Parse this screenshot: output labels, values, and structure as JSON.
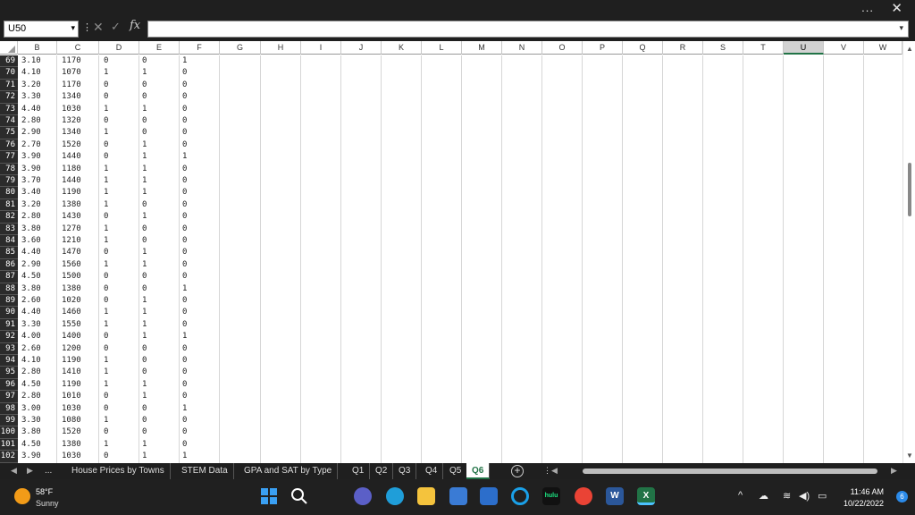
{
  "window": {
    "more_label": "...",
    "close_label": "✕"
  },
  "formula_bar": {
    "name_box": "U50",
    "formula": "",
    "fx_label": "fx"
  },
  "columns": [
    "B",
    "C",
    "D",
    "E",
    "F",
    "G",
    "H",
    "I",
    "J",
    "K",
    "L",
    "M",
    "N",
    "O",
    "P",
    "Q",
    "R",
    "S",
    "T",
    "U",
    "V",
    "W"
  ],
  "selected_column": "U",
  "rows": [
    {
      "n": "69",
      "b": "3.10",
      "c": "1170",
      "d": "0",
      "e": "0",
      "f": "1"
    },
    {
      "n": "70",
      "b": "4.10",
      "c": "1070",
      "d": "1",
      "e": "1",
      "f": "0"
    },
    {
      "n": "71",
      "b": "3.20",
      "c": "1170",
      "d": "0",
      "e": "0",
      "f": "0"
    },
    {
      "n": "72",
      "b": "3.30",
      "c": "1340",
      "d": "0",
      "e": "0",
      "f": "0"
    },
    {
      "n": "73",
      "b": "4.40",
      "c": "1030",
      "d": "1",
      "e": "1",
      "f": "0"
    },
    {
      "n": "74",
      "b": "2.80",
      "c": "1320",
      "d": "0",
      "e": "0",
      "f": "0"
    },
    {
      "n": "75",
      "b": "2.90",
      "c": "1340",
      "d": "1",
      "e": "0",
      "f": "0"
    },
    {
      "n": "76",
      "b": "2.70",
      "c": "1520",
      "d": "0",
      "e": "1",
      "f": "0"
    },
    {
      "n": "77",
      "b": "3.90",
      "c": "1440",
      "d": "0",
      "e": "1",
      "f": "1"
    },
    {
      "n": "78",
      "b": "3.90",
      "c": "1180",
      "d": "1",
      "e": "1",
      "f": "0"
    },
    {
      "n": "79",
      "b": "3.70",
      "c": "1440",
      "d": "1",
      "e": "1",
      "f": "0"
    },
    {
      "n": "80",
      "b": "3.40",
      "c": "1190",
      "d": "1",
      "e": "1",
      "f": "0"
    },
    {
      "n": "81",
      "b": "3.20",
      "c": "1380",
      "d": "1",
      "e": "0",
      "f": "0"
    },
    {
      "n": "82",
      "b": "2.80",
      "c": "1430",
      "d": "0",
      "e": "1",
      "f": "0"
    },
    {
      "n": "83",
      "b": "3.80",
      "c": "1270",
      "d": "1",
      "e": "0",
      "f": "0"
    },
    {
      "n": "84",
      "b": "3.60",
      "c": "1210",
      "d": "1",
      "e": "0",
      "f": "0"
    },
    {
      "n": "85",
      "b": "4.40",
      "c": "1470",
      "d": "0",
      "e": "1",
      "f": "0"
    },
    {
      "n": "86",
      "b": "2.90",
      "c": "1560",
      "d": "1",
      "e": "1",
      "f": "0"
    },
    {
      "n": "87",
      "b": "4.50",
      "c": "1500",
      "d": "0",
      "e": "0",
      "f": "0"
    },
    {
      "n": "88",
      "b": "3.80",
      "c": "1380",
      "d": "0",
      "e": "0",
      "f": "1"
    },
    {
      "n": "89",
      "b": "2.60",
      "c": "1020",
      "d": "0",
      "e": "1",
      "f": "0"
    },
    {
      "n": "90",
      "b": "4.40",
      "c": "1460",
      "d": "1",
      "e": "1",
      "f": "0"
    },
    {
      "n": "91",
      "b": "3.30",
      "c": "1550",
      "d": "1",
      "e": "1",
      "f": "0"
    },
    {
      "n": "92",
      "b": "4.00",
      "c": "1400",
      "d": "0",
      "e": "1",
      "f": "1"
    },
    {
      "n": "93",
      "b": "2.60",
      "c": "1200",
      "d": "0",
      "e": "0",
      "f": "0"
    },
    {
      "n": "94",
      "b": "4.10",
      "c": "1190",
      "d": "1",
      "e": "0",
      "f": "0"
    },
    {
      "n": "95",
      "b": "2.80",
      "c": "1410",
      "d": "1",
      "e": "0",
      "f": "0"
    },
    {
      "n": "96",
      "b": "4.50",
      "c": "1190",
      "d": "1",
      "e": "1",
      "f": "0"
    },
    {
      "n": "97",
      "b": "2.80",
      "c": "1010",
      "d": "0",
      "e": "1",
      "f": "0"
    },
    {
      "n": "98",
      "b": "3.00",
      "c": "1030",
      "d": "0",
      "e": "0",
      "f": "1"
    },
    {
      "n": "99",
      "b": "3.30",
      "c": "1080",
      "d": "1",
      "e": "0",
      "f": "0"
    },
    {
      "n": "100",
      "b": "3.80",
      "c": "1520",
      "d": "0",
      "e": "0",
      "f": "0"
    },
    {
      "n": "101",
      "b": "4.50",
      "c": "1380",
      "d": "1",
      "e": "1",
      "f": "0"
    },
    {
      "n": "102",
      "b": "3.90",
      "c": "1030",
      "d": "0",
      "e": "1",
      "f": "1"
    }
  ],
  "sheet_tabs": {
    "ellipsis": "...",
    "tabs": [
      "House Prices by Towns",
      "STEM Data",
      "GPA and SAT by Type",
      "Q1",
      "Q2",
      "Q3",
      "Q4",
      "Q5",
      "Q6"
    ],
    "active": "Q6",
    "add_label": "+"
  },
  "taskbar": {
    "weather_temp": "58°F",
    "weather_desc": "Sunny",
    "time": "11:46 AM",
    "date": "10/22/2022",
    "notification_count": "6",
    "hulu_label": "hulu",
    "word_label": "W",
    "excel_label": "X"
  },
  "colors": {
    "excel_green": "#217346",
    "accent_blue": "#2b8ae8",
    "weather_orange": "#f29b18"
  }
}
